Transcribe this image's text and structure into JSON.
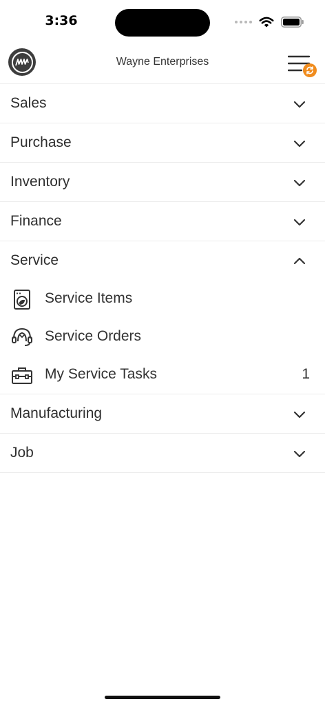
{
  "status_bar": {
    "time": "3:36"
  },
  "header": {
    "company_name": "Wayne Enterprises",
    "logo_icon": "company-logo-icon",
    "menu_icon": "hamburger-menu-icon",
    "badge_icon": "sync-icon",
    "badge_color": "#f08c1e"
  },
  "menu": {
    "sales": "Sales",
    "purchase": "Purchase",
    "inventory": "Inventory",
    "finance": "Finance",
    "service": "Service",
    "service_items": [
      {
        "label": "Service Items",
        "icon": "washing-machine-icon",
        "count": ""
      },
      {
        "label": "Service Orders",
        "icon": "headset-agent-icon",
        "count": ""
      },
      {
        "label": "My Service Tasks",
        "icon": "toolbox-icon",
        "count": "1"
      }
    ],
    "manufacturing": "Manufacturing",
    "job": "Job"
  }
}
